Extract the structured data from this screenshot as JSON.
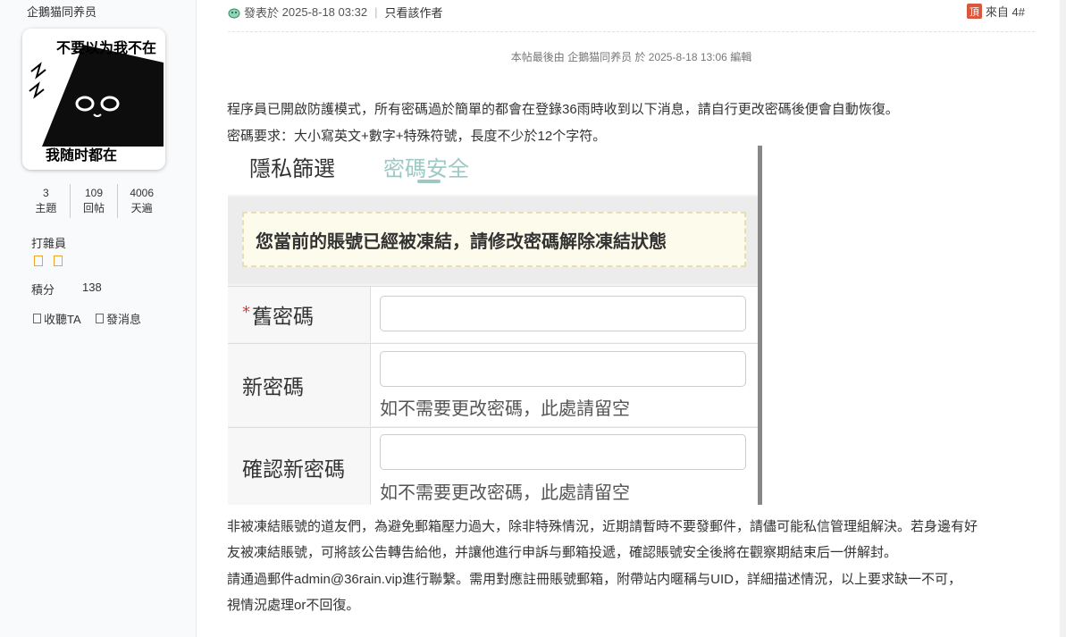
{
  "user": {
    "name": "企鵝猫同养员",
    "avatar_text_top": "不要以为我不在",
    "avatar_text_bottom": "我随时都在",
    "stats": [
      {
        "value": "3",
        "label": "主題"
      },
      {
        "value": "109",
        "label": "回帖"
      },
      {
        "value": "4006",
        "label": "天遍"
      }
    ],
    "rank": "打雜員",
    "stars": 2,
    "points_label": "積分",
    "points_value": "138",
    "follow_label": "收聽TA",
    "message_label": "發消息"
  },
  "post": {
    "posted_label": "發表於",
    "posted_time": "2025-8-18 03:32",
    "author_only": "只看該作者",
    "top_icon": "頂",
    "floor": "來自 4#",
    "edit_note": "本帖最後由 企鵝猫同养员 於 2025-8-18 13:06 編輯",
    "paragraphs": [
      "程序員已開啟防護模式，所有密碼過於簡單的都會在登錄36雨時收到以下消息，請自行更改密碼後便會自動恢復。",
      "密碼要求：大小寫英文+數字+特殊符號，長度不少於12个字符。",
      "非被凍結賬號的道友們，為避免郵箱壓力過大，除非特殊情況，近期請暫時不要發郵件，請儘可能私信管理組解決。若身邊有好",
      "友被凍結賬號，可將該公告轉告給他，并讓他進行申訴与郵箱投遞，確認賬號安全後將在觀察期結束后一併解封。",
      "請通過郵件admin@36rain.vip進行聯繫。需用對應註冊賬號郵箱，附帶站内暱稱与UID，詳細描述情況，以上要求缺一不可，",
      "視情況處理or不回復。"
    ]
  },
  "screenshot": {
    "tab_privacy": "隱私篩選",
    "tab_security": "密碼安全",
    "notice": "您當前的賬號已經被凍結，請修改密碼解除凍結狀態",
    "required_mark": "*",
    "old_password_label": "舊密碼",
    "new_password_label": "新密碼",
    "confirm_password_label": "確認新密碼",
    "hint": "如不需要更改密碼，此處請留空",
    "hint_confirm": "如不需要更改密碼，此處請留空"
  },
  "colors": {
    "accent_teal": "#9ec9c3",
    "star": "#f0a52a",
    "top_badge": "#d9573d",
    "required": "#d9363e"
  }
}
